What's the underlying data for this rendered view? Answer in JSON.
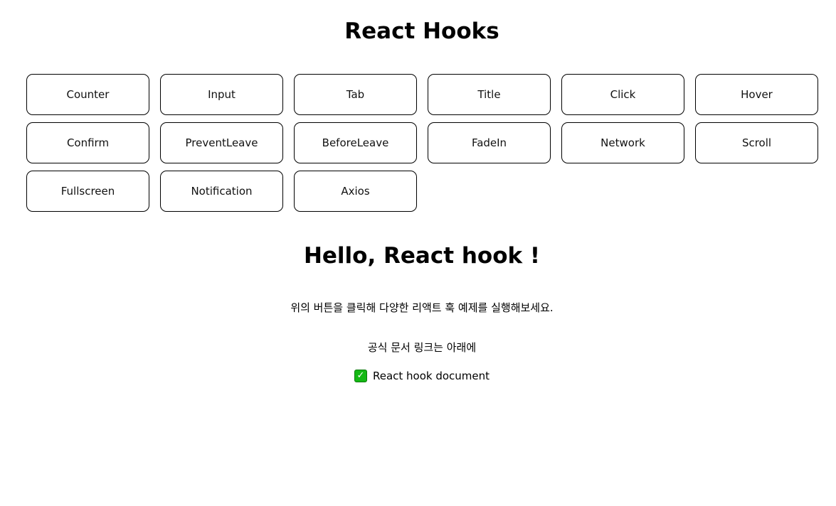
{
  "header": {
    "title": "React Hooks"
  },
  "hook_buttons": [
    "Counter",
    "Input",
    "Tab",
    "Title",
    "Click",
    "Hover",
    "Confirm",
    "PreventLeave",
    "BeforeLeave",
    "FadeIn",
    "Network",
    "Scroll",
    "Fullscreen",
    "Notification",
    "Axios"
  ],
  "main": {
    "heading": "Hello, React hook !",
    "description": "위의 버튼을 클릭해 다양한 리액트 훅 예제를 실행해보세요.",
    "link_intro": "공식 문서 링크는 아래에",
    "doc_link": {
      "icon": "check-icon",
      "label": "React hook document",
      "icon_color": "#14b814"
    }
  }
}
